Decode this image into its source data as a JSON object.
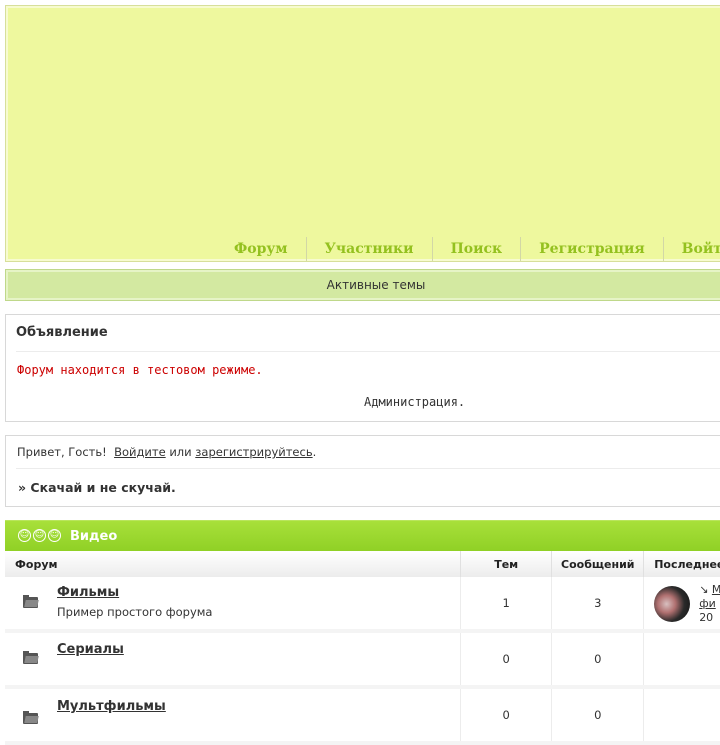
{
  "nav": {
    "items": [
      "Форум",
      "Участники",
      "Поиск",
      "Регистрация",
      "Войти"
    ]
  },
  "active_topics_label": "Активные темы",
  "announcement": {
    "title": "Объявление",
    "message": "Форум находится в тестовом режиме.",
    "signature": "Администрация."
  },
  "welcome": {
    "greeting": "Привет, Гость!",
    "login_link": "Войдите",
    "or_text": "или",
    "register_link": "зарегистрируйтесь",
    "period": ".",
    "motto": "» Скачай и не скучай."
  },
  "category": {
    "title": "Видео",
    "icons": [
      "smiley-icon",
      "smiley-icon",
      "smiley-icon"
    ]
  },
  "table": {
    "headers": {
      "forum": "Форум",
      "topics": "Тем",
      "posts": "Сообщений",
      "last": "Последнее"
    },
    "rows": [
      {
        "name": "Фильмы",
        "description": "Пример простого форума",
        "topics": "1",
        "posts": "3",
        "last_prefix": "↘",
        "last_link": "М",
        "last_line2": "фи",
        "last_line3": "20"
      },
      {
        "name": "Сериалы",
        "description": "",
        "topics": "0",
        "posts": "0"
      },
      {
        "name": "Мультфильмы",
        "description": "",
        "topics": "0",
        "posts": "0"
      }
    ]
  },
  "colors": {
    "header_bg": "#eef89e",
    "nav_link": "#94c11f",
    "category_bg": "#9bd52e",
    "announce_text": "#cc0000"
  }
}
